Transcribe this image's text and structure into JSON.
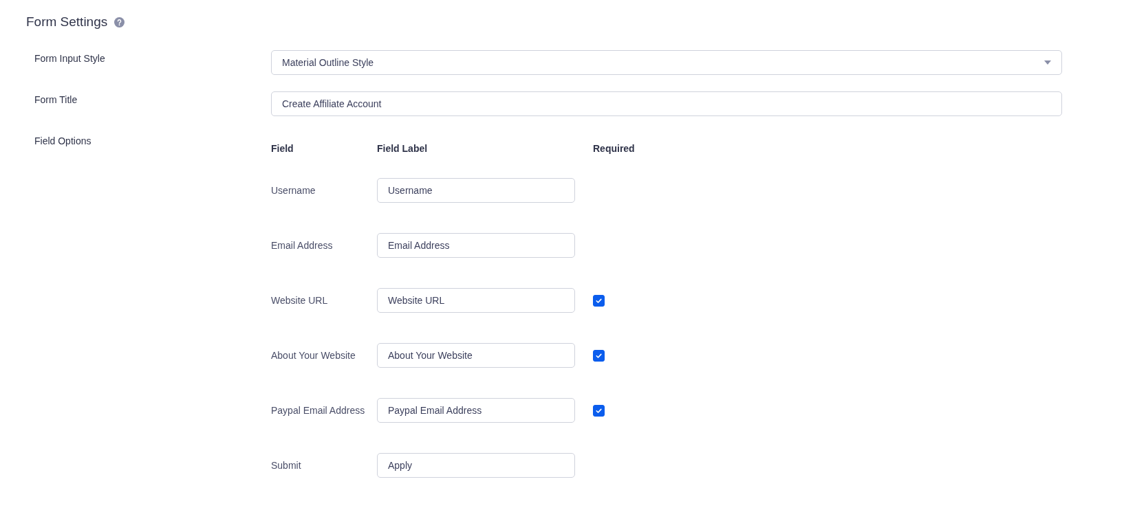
{
  "section": {
    "title": "Form Settings"
  },
  "settings": [
    {
      "label": "Form Input Style",
      "kind": "select",
      "value": "Material Outline Style"
    },
    {
      "label": "Form Title",
      "kind": "text",
      "value": "Create Affiliate Account"
    }
  ],
  "field_options": {
    "label": "Field Options",
    "columns": [
      "Field",
      "Field Label",
      "Required"
    ],
    "rows": [
      {
        "field": "Username",
        "value": "Username"
      },
      {
        "field": "Email Address",
        "value": "Email Address"
      },
      {
        "field": "Website URL",
        "value": "Website URL",
        "required": true
      },
      {
        "field": "About Your Website",
        "value": "About Your Website",
        "required": true
      },
      {
        "field": "Paypal Email Address",
        "value": "Paypal Email Address",
        "required": true
      },
      {
        "field": "Submit",
        "value": "Apply"
      }
    ]
  }
}
